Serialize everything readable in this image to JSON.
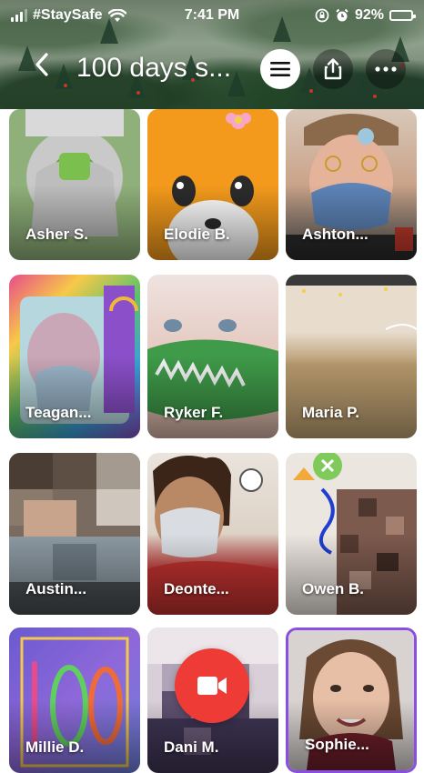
{
  "status": {
    "carrier": "#StaySafe",
    "time": "7:41 PM",
    "battery": "92%",
    "battery_level": 0.92
  },
  "nav": {
    "title": "100 days s..."
  },
  "icons": {
    "back": "chevron-left-icon",
    "menu": "hamburger-menu-icon",
    "share": "share-icon",
    "more": "more-dots-icon",
    "record": "video-camera-icon"
  },
  "colors": {
    "record": "#ef3b36"
  },
  "videos": [
    {
      "name": "Asher S."
    },
    {
      "name": "Elodie B."
    },
    {
      "name": "Ashton..."
    },
    {
      "name": "Teagan..."
    },
    {
      "name": "Ryker F."
    },
    {
      "name": "Maria P."
    },
    {
      "name": "Austin..."
    },
    {
      "name": "Deonte..."
    },
    {
      "name": "Owen B."
    },
    {
      "name": "Millie D."
    },
    {
      "name": "Dani M."
    },
    {
      "name": "Sophie..."
    }
  ]
}
